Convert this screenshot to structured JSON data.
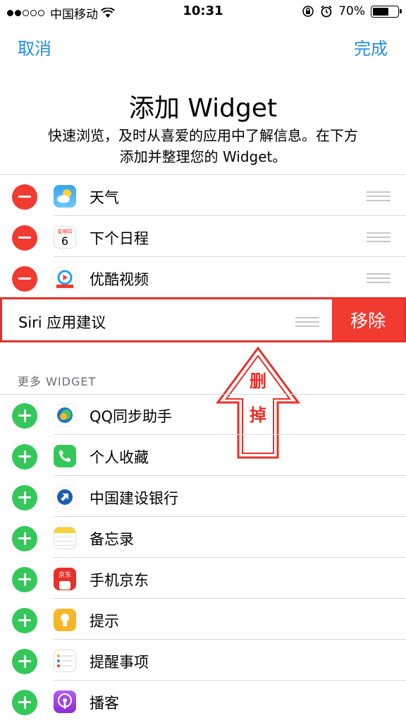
{
  "status_bar": {
    "carrier": "中国移动",
    "time": "10:31",
    "battery_percent": "70%",
    "battery_level": 0.7
  },
  "nav": {
    "cancel": "取消",
    "done": "完成"
  },
  "header": {
    "title": "添加 Widget",
    "subtitle_line1": "快速浏览，及时从喜爱的应用中了解信息。在下方",
    "subtitle_line2": "添加并整理您的 Widget。"
  },
  "active_widgets": [
    {
      "label": "天气",
      "icon": "weather-icon"
    },
    {
      "label": "下个日程",
      "icon": "calendar-icon",
      "icon_text": "星期四",
      "icon_day": "6"
    },
    {
      "label": "优酷视频",
      "icon": "youku-icon"
    }
  ],
  "siri_row": {
    "label": "Siri 应用建议",
    "remove_label": "移除"
  },
  "annotation": {
    "line1": "删",
    "line2": "掉",
    "color": "#e8302a"
  },
  "more_section": {
    "header": "更多 WIDGET",
    "items": [
      {
        "label": "QQ同步助手",
        "icon": "qq-sync-icon"
      },
      {
        "label": "个人收藏",
        "icon": "phone-icon"
      },
      {
        "label": "中国建设银行",
        "icon": "ccb-icon"
      },
      {
        "label": "备忘录",
        "icon": "notes-icon"
      },
      {
        "label": "手机京东",
        "icon": "jd-icon",
        "icon_text": "京东"
      },
      {
        "label": "提示",
        "icon": "tips-icon"
      },
      {
        "label": "提醒事项",
        "icon": "reminders-icon"
      },
      {
        "label": "播客",
        "icon": "podcasts-icon"
      }
    ]
  },
  "colors": {
    "accent": "#1f8de5",
    "delete": "#f13a30",
    "add": "#34c85a"
  }
}
